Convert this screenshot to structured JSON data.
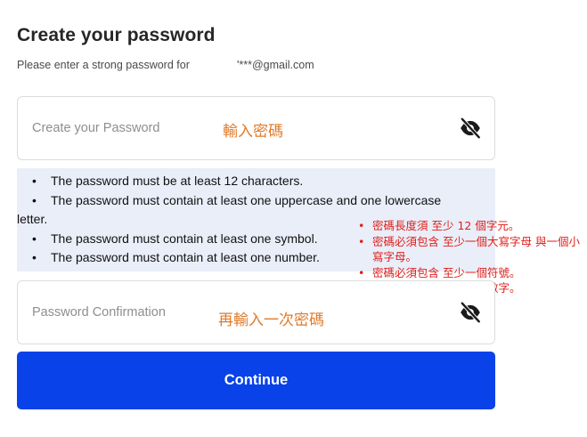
{
  "header": {
    "title": "Create your password",
    "subtitle": "Please enter a strong password for",
    "email": "'***@gmail.com"
  },
  "password_field": {
    "placeholder": "Create your Password",
    "annotation": "輸入密碼",
    "toggle_icon": "eye-off-icon"
  },
  "requirements": [
    "The password must be at least 12 characters.",
    "The password must contain at least one uppercase and one lowercase",
    "The password must contain at least one symbol.",
    "The password must contain at least one number."
  ],
  "requirements_wrap": "letter.",
  "annotations_cn": [
    "密碼長度須 至少 12 個字元。",
    "密碼必須包含 至少一個大寫字母 與一個小寫字母。",
    "密碼必須包含 至少一個符號。",
    "密碼必須包含 至少一個數字。"
  ],
  "confirm_field": {
    "placeholder": "Password Confirmation",
    "annotation": "再輸入一次密碼",
    "toggle_icon": "eye-off-icon"
  },
  "continue_button": {
    "label": "Continue"
  },
  "colors": {
    "primary": "#0842e8",
    "annotation_orange": "#e07b2a",
    "annotation_red": "#e0201b",
    "requirements_bg": "#e9eef9"
  }
}
